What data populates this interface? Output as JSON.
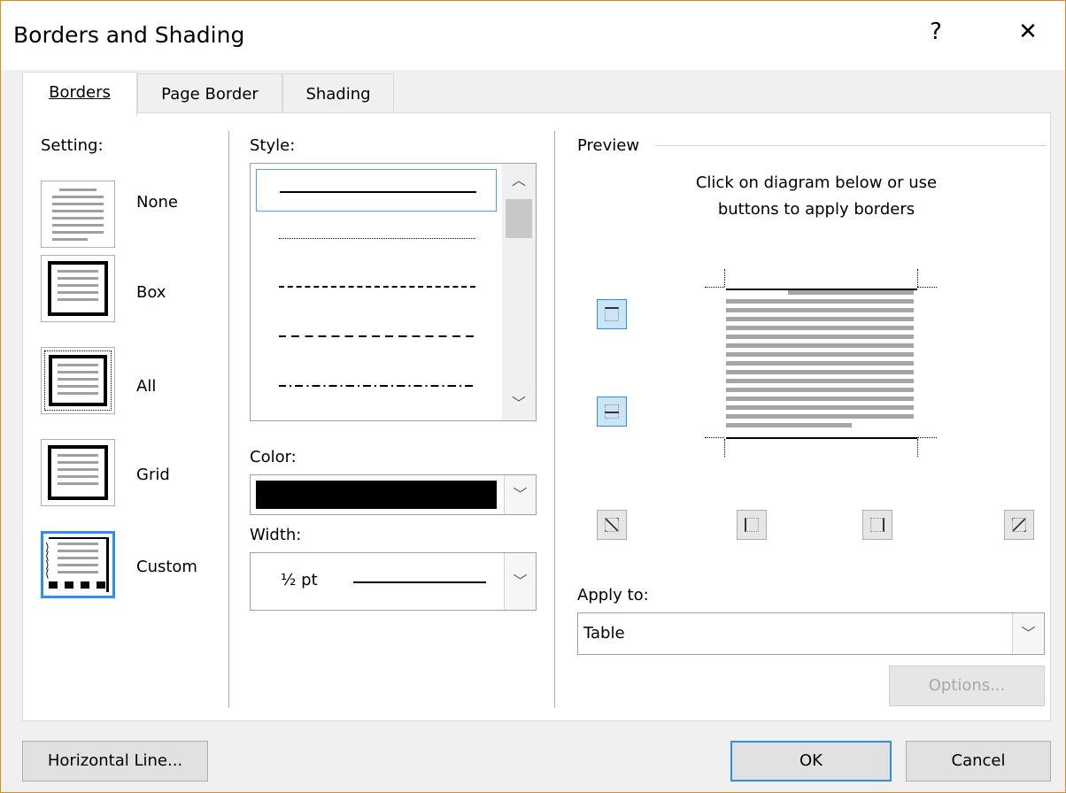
{
  "window": {
    "title": "Borders and Shading",
    "help_label": "?",
    "close_label": "✕"
  },
  "tabs": [
    {
      "label": "Borders",
      "active": true
    },
    {
      "label": "Page Border",
      "active": false
    },
    {
      "label": "Shading",
      "active": false
    }
  ],
  "setting": {
    "heading": "Setting:",
    "options": [
      {
        "label": "None",
        "selected": false
      },
      {
        "label": "Box",
        "selected": false
      },
      {
        "label": "All",
        "selected": false
      },
      {
        "label": "Grid",
        "selected": false
      },
      {
        "label": "Custom",
        "selected": true
      }
    ]
  },
  "style": {
    "heading": "Style:",
    "items": [
      "solid",
      "dotted",
      "dashed-small",
      "dashed",
      "dash-dot"
    ],
    "selected_index": 0
  },
  "color": {
    "label": "Color:",
    "value": "#000000"
  },
  "width": {
    "label": "Width:",
    "value": "½ pt"
  },
  "preview": {
    "heading": "Preview",
    "instruction_line1": "Click on diagram below or use",
    "instruction_line2": "buttons to apply borders"
  },
  "apply_to": {
    "label": "Apply to:",
    "value": "Table"
  },
  "buttons": {
    "options": "Options...",
    "horizontal_line": "Horizontal Line...",
    "ok": "OK",
    "cancel": "Cancel"
  },
  "colors": {
    "accent": "#2f8ee8",
    "title_border": "#e38a1e"
  }
}
